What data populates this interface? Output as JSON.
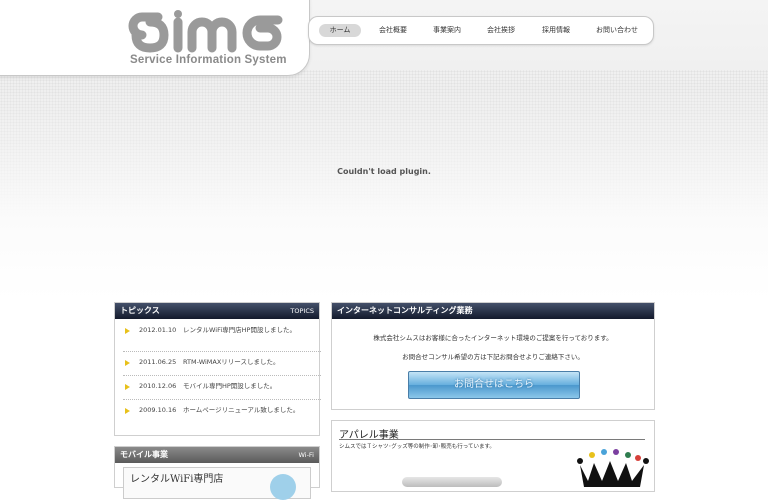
{
  "header": {
    "logo_text": "Service Information System",
    "nav": [
      {
        "label": "ホーム",
        "active": true
      },
      {
        "label": "会社概要"
      },
      {
        "label": "事業案内"
      },
      {
        "label": "会社挨拶"
      },
      {
        "label": "採用情報"
      },
      {
        "label": "お問い合わせ"
      }
    ]
  },
  "plugin_message": "Couldn't load plugin.",
  "topics": {
    "title": "トピックス",
    "title_en": "TOPICS",
    "items": [
      {
        "date": "2012.01.10",
        "text": "レンタルWiFi専門店HP開設しました。"
      },
      {
        "date": "2011.06.25",
        "text": "RTM-WiMAXリリースしました。"
      },
      {
        "date": "2010.12.06",
        "text": "モバイル専門HP開設しました。"
      },
      {
        "date": "2009.10.16",
        "text": "ホームページリニューアル致しました。"
      }
    ]
  },
  "mobile": {
    "title": "モバイル事業",
    "title_en": "Wi-Fi",
    "banner_text": "レンタルWiFi専門店"
  },
  "consulting": {
    "title": "インターネットコンサルティング業務",
    "line1": "株式会社シムスはお客様に合ったインターネット環境のご提案を行っております。",
    "line2": "お問合せコンサル希望の方は下記お問合せよりご連絡下さい。",
    "button": "お問合せはこちら"
  },
  "apparel": {
    "title": "アパレル事業",
    "text": "シムスではＴシャツ･グッズ等の制作･卸･販売も行っています。"
  },
  "colors": {
    "header_bar_dark": "#1c2438",
    "header_bar_grey": "#6e6e6e",
    "topic_arrow": "#e8c11b",
    "button_blue": "#5aa7d8"
  }
}
